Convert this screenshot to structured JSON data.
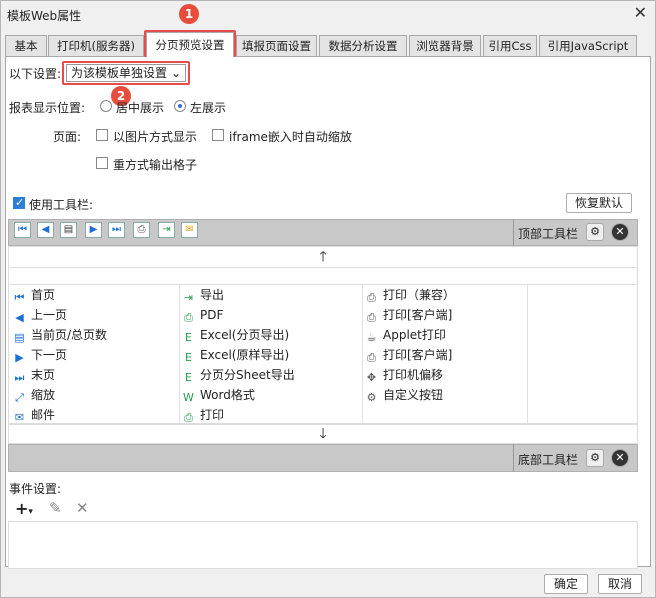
{
  "window": {
    "title": "模板Web属性"
  },
  "tabs": [
    {
      "label": "基本"
    },
    {
      "label": "打印机(服务器)"
    },
    {
      "label": "分页预览设置"
    },
    {
      "label": "填报页面设置"
    },
    {
      "label": "数据分析设置"
    },
    {
      "label": "浏览器背景"
    },
    {
      "label": "引用Css"
    },
    {
      "label": "引用JavaScript"
    }
  ],
  "badges": {
    "one": "1",
    "two": "2"
  },
  "settings": {
    "label": "以下设置:",
    "select_value": "为该模板单独设置"
  },
  "position": {
    "label": "报表显示位置:",
    "center": "居中展示",
    "left": "左展示"
  },
  "page": {
    "label": "页面:",
    "image_mode": "以图片方式显示",
    "iframe_zoom": "iframe嵌入时自动缩放",
    "repeat_output": "重方式输出格子"
  },
  "toolbar": {
    "use_label": "使用工具栏:",
    "restore_default": "恢复默认",
    "top_label": "顶部工具栏",
    "bottom_label": "底部工具栏"
  },
  "items": {
    "col1": [
      {
        "icon": "first-page-icon",
        "glyph": "⏮",
        "label": "首页"
      },
      {
        "icon": "prev-page-icon",
        "glyph": "◀",
        "label": "上一页"
      },
      {
        "icon": "page-number-icon",
        "glyph": "▤",
        "label": "当前页/总页数"
      },
      {
        "icon": "next-page-icon",
        "glyph": "▶",
        "label": "下一页"
      },
      {
        "icon": "last-page-icon",
        "glyph": "⏭",
        "label": "末页"
      },
      {
        "icon": "zoom-icon",
        "glyph": "⤢",
        "label": "缩放"
      },
      {
        "icon": "email-icon",
        "glyph": "✉",
        "label": "邮件"
      }
    ],
    "col2": [
      {
        "icon": "export-icon",
        "glyph": "⇥",
        "label": "导出"
      },
      {
        "icon": "pdf-icon",
        "glyph": "⎙",
        "label": "PDF"
      },
      {
        "icon": "excel-page-icon",
        "glyph": "E",
        "label": "Excel(分页导出)"
      },
      {
        "icon": "excel-original-icon",
        "glyph": "E",
        "label": "Excel(原样导出)"
      },
      {
        "icon": "excel-sheet-icon",
        "glyph": "E",
        "label": "分页分Sheet导出"
      },
      {
        "icon": "word-icon",
        "glyph": "W",
        "label": "Word格式"
      },
      {
        "icon": "print-icon",
        "glyph": "⎙",
        "label": "打印"
      }
    ],
    "col3": [
      {
        "icon": "print-compat-icon",
        "glyph": "⎙",
        "label": "打印（兼容）"
      },
      {
        "icon": "print-client-icon",
        "glyph": "⎙",
        "label": "打印[客户端]"
      },
      {
        "icon": "applet-print-icon",
        "glyph": "☕",
        "label": "Applet打印"
      },
      {
        "icon": "print-client-icon",
        "glyph": "⎙",
        "label": "打印[客户端]"
      },
      {
        "icon": "printer-offset-icon",
        "glyph": "✥",
        "label": "打印机偏移"
      },
      {
        "icon": "custom-button-icon",
        "glyph": "⚙",
        "label": "自定义按钮"
      }
    ]
  },
  "events": {
    "label": "事件设置:"
  },
  "footer": {
    "ok": "确定",
    "cancel": "取消"
  }
}
